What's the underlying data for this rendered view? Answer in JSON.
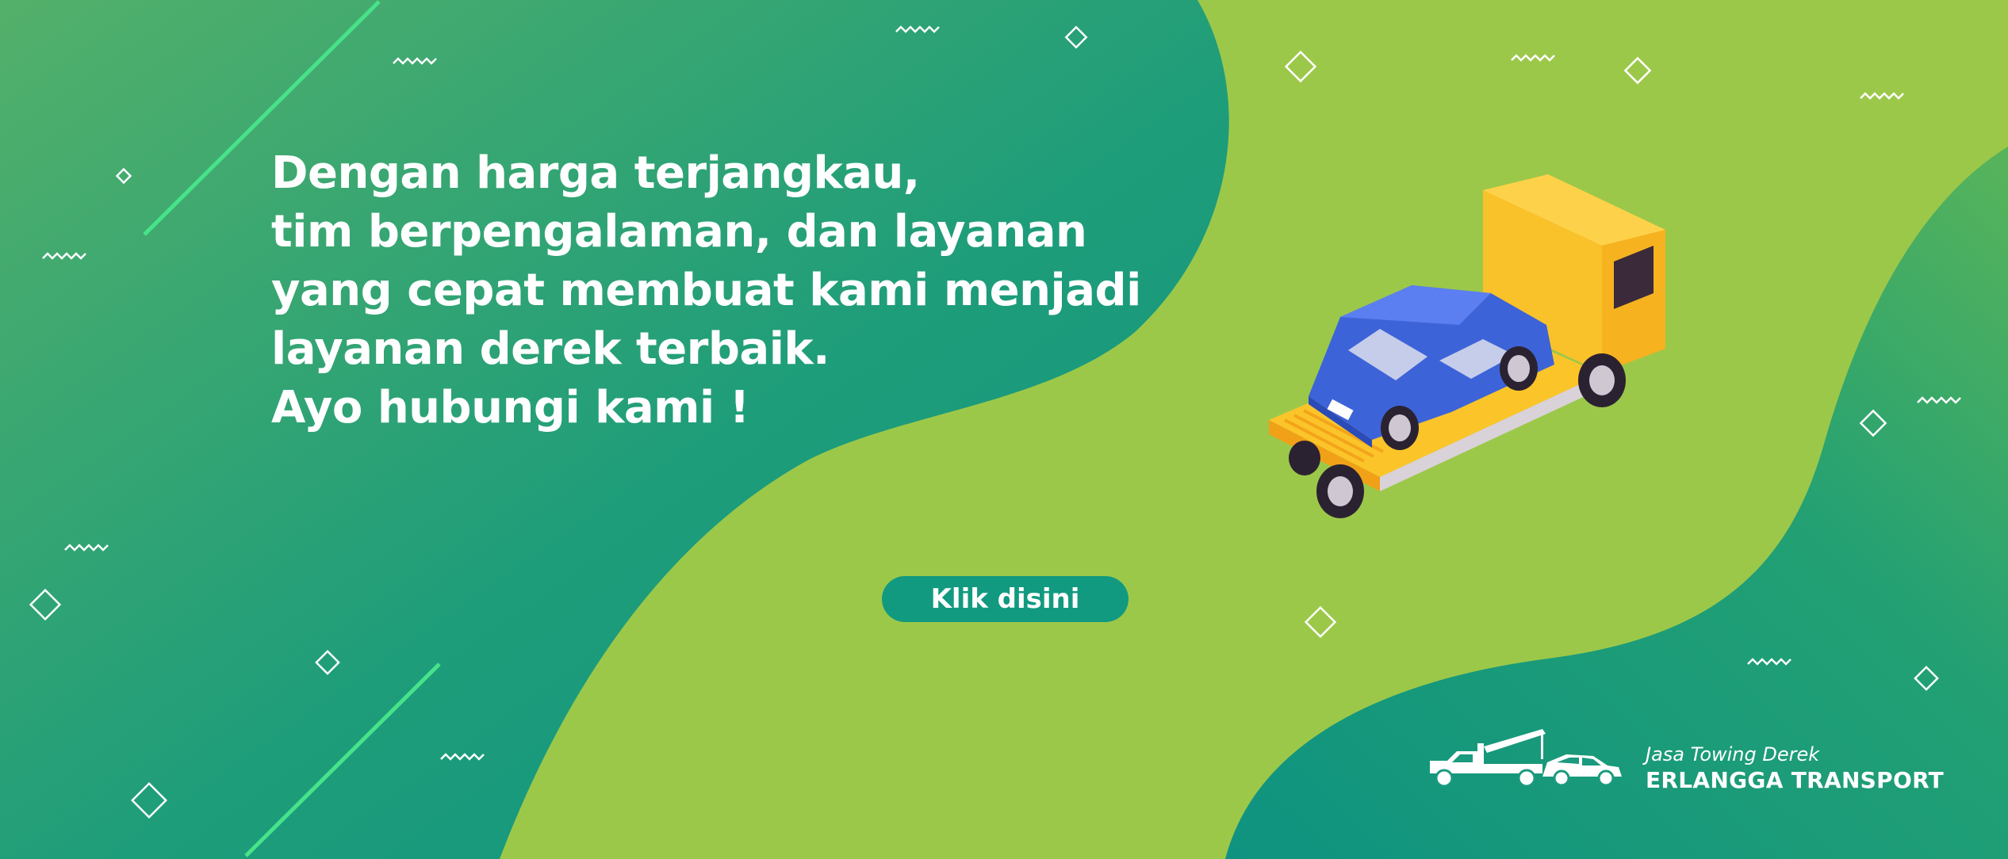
{
  "headline": {
    "lines": [
      "Dengan harga terjangkau,",
      "tim berpengalaman, dan layanan",
      "yang cepat membuat kami menjadi",
      "layanan derek terbaik.",
      "Ayo hubungi kami !"
    ]
  },
  "cta": {
    "label": "Klik disini"
  },
  "brand": {
    "tagline": "Jasa Towing Derek",
    "name": "ERLANGGA TRANSPORT",
    "logo_icon": "tow-truck-icon"
  },
  "illustration": {
    "icon": "flatbed-tow-truck-with-car"
  },
  "colors": {
    "background_lime": "#9cc84a",
    "wave_green_dark": "#12967e",
    "wave_green_light": "#4caf6a",
    "button": "#119a80",
    "text": "#ffffff",
    "truck_yellow": "#f9bb22",
    "car_blue": "#3d63d8"
  }
}
